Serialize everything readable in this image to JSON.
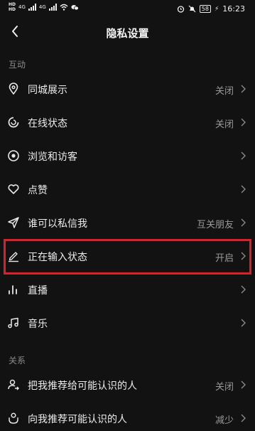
{
  "status_bar": {
    "hd1": "HD",
    "hd2": "HD",
    "net1": "4G",
    "net2": "4G",
    "battery": "58",
    "time": "16:23"
  },
  "header": {
    "title": "隐私设置"
  },
  "sections": {
    "interaction": "互动",
    "relations": "关系"
  },
  "rows": [
    {
      "icon": "location-pin-icon",
      "label": "同城展示",
      "value": "关闭"
    },
    {
      "icon": "online-status-icon",
      "label": "在线状态",
      "value": "关闭"
    },
    {
      "icon": "eye-icon",
      "label": "浏览和访客",
      "value": ""
    },
    {
      "icon": "heart-icon",
      "label": "点赞",
      "value": ""
    },
    {
      "icon": "send-icon",
      "label": "谁可以私信我",
      "value": "互关朋友"
    },
    {
      "icon": "pencil-icon",
      "label": "正在输入状态",
      "value": "开启"
    },
    {
      "icon": "live-bars-icon",
      "label": "直播",
      "value": ""
    },
    {
      "icon": "music-note-icon",
      "label": "音乐",
      "value": ""
    },
    {
      "icon": "user-recommend-icon",
      "label": "把我推荐给可能认识的人",
      "value": "关闭"
    },
    {
      "icon": "user-link-icon",
      "label": "向我推荐可能认识的人",
      "value": "减少"
    }
  ],
  "colors": {
    "background": "#121212",
    "highlight": "#e01e2a",
    "text": "#ececec",
    "muted": "#9a9a9a"
  }
}
